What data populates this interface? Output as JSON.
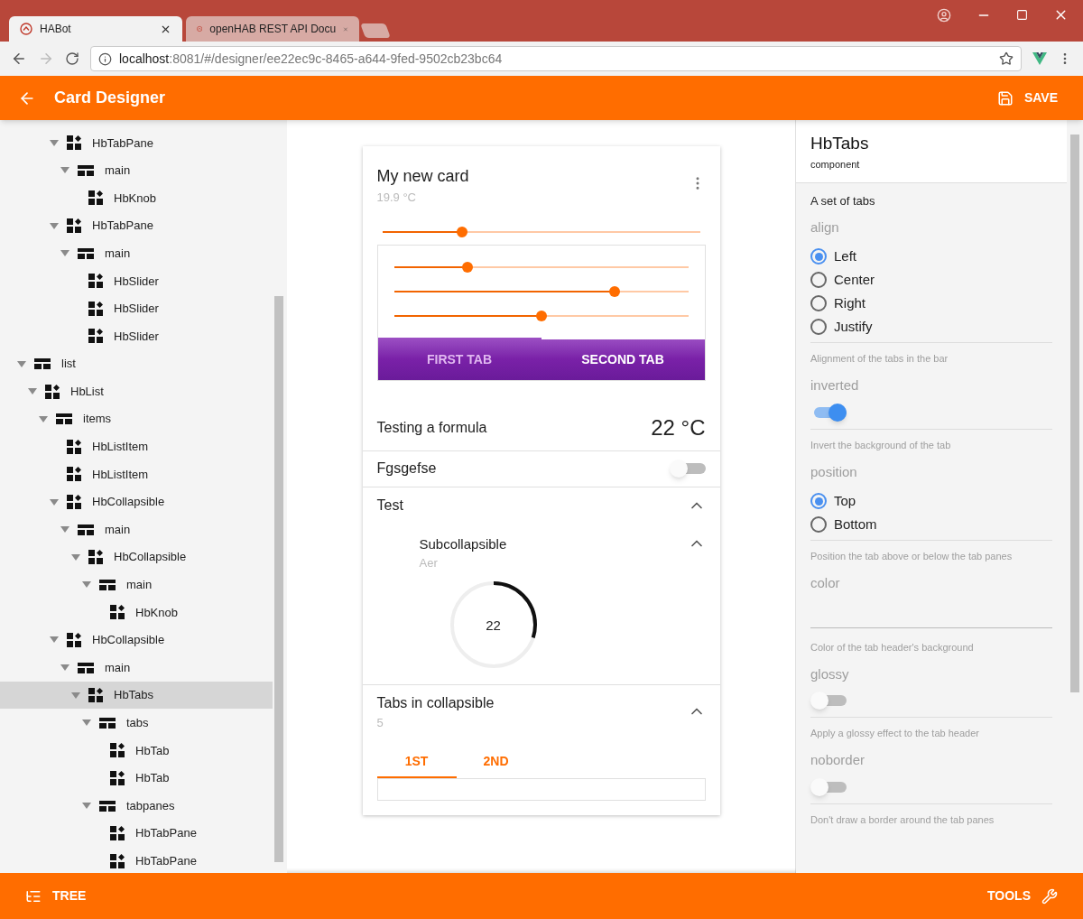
{
  "browser": {
    "tabs": [
      {
        "title": "HABot",
        "selected": true
      },
      {
        "title": "openHAB REST API Docu",
        "selected": false
      }
    ],
    "url_host": "localhost",
    "url_path": ":8081/#/designer/ee22ec9c-8465-a644-9fed-9502cb23bc64"
  },
  "header": {
    "title": "Card Designer",
    "save": "SAVE"
  },
  "tree": {
    "scrolled_branch": [
      {
        "label": "HbTabPane",
        "kind": "component",
        "expanded": true,
        "selected": false,
        "children": [
          {
            "label": "main",
            "kind": "slot",
            "expanded": true,
            "selected": false,
            "children": [
              {
                "label": "HbKnob",
                "kind": "component",
                "selected": false
              }
            ]
          }
        ]
      },
      {
        "label": "HbTabPane",
        "kind": "component",
        "expanded": true,
        "selected": false,
        "children": [
          {
            "label": "main",
            "kind": "slot",
            "expanded": true,
            "selected": false,
            "children": [
              {
                "label": "HbSlider",
                "kind": "component",
                "selected": false
              },
              {
                "label": "HbSlider",
                "kind": "component",
                "selected": false
              },
              {
                "label": "HbSlider",
                "kind": "component",
                "selected": false
              }
            ]
          }
        ]
      }
    ],
    "items": [
      {
        "label": "list",
        "kind": "slot",
        "expanded": true,
        "selected": false,
        "children": [
          {
            "label": "HbList",
            "kind": "component",
            "expanded": true,
            "selected": false,
            "children": [
              {
                "label": "items",
                "kind": "slot",
                "expanded": true,
                "selected": false,
                "children": [
                  {
                    "label": "HbListItem",
                    "kind": "component",
                    "selected": false
                  },
                  {
                    "label": "HbListItem",
                    "kind": "component",
                    "selected": false
                  },
                  {
                    "label": "HbCollapsible",
                    "kind": "component",
                    "expanded": true,
                    "selected": false,
                    "children": [
                      {
                        "label": "main",
                        "kind": "slot",
                        "expanded": true,
                        "selected": false,
                        "children": [
                          {
                            "label": "HbCollapsible",
                            "kind": "component",
                            "expanded": true,
                            "selected": false,
                            "children": [
                              {
                                "label": "main",
                                "kind": "slot",
                                "expanded": true,
                                "selected": false,
                                "children": [
                                  {
                                    "label": "HbKnob",
                                    "kind": "component",
                                    "selected": false
                                  }
                                ]
                              }
                            ]
                          }
                        ]
                      }
                    ]
                  },
                  {
                    "label": "HbCollapsible",
                    "kind": "component",
                    "expanded": true,
                    "selected": false,
                    "children": [
                      {
                        "label": "main",
                        "kind": "slot",
                        "expanded": true,
                        "selected": false,
                        "children": [
                          {
                            "label": "HbTabs",
                            "kind": "component",
                            "expanded": true,
                            "selected": true,
                            "children": [
                              {
                                "label": "tabs",
                                "kind": "slot",
                                "expanded": true,
                                "selected": false,
                                "children": [
                                  {
                                    "label": "HbTab",
                                    "kind": "component",
                                    "selected": false
                                  },
                                  {
                                    "label": "HbTab",
                                    "kind": "component",
                                    "selected": false
                                  }
                                ]
                              },
                              {
                                "label": "tabpanes",
                                "kind": "slot",
                                "expanded": true,
                                "selected": false,
                                "children": [
                                  {
                                    "label": "HbTabPane",
                                    "kind": "component",
                                    "selected": false
                                  },
                                  {
                                    "label": "HbTabPane",
                                    "kind": "component",
                                    "selected": false
                                  }
                                ]
                              }
                            ]
                          }
                        ]
                      }
                    ]
                  }
                ]
              }
            ]
          }
        ]
      }
    ]
  },
  "card": {
    "title": "My new card",
    "subtitle": "19.9 °C",
    "slider": {
      "level": 0.25
    },
    "tabs_block": {
      "sliders": [
        {
          "level": 0.25
        },
        {
          "level": 0.75
        },
        {
          "level": 0.5
        }
      ],
      "tabs": [
        {
          "label": "FIRST TAB",
          "selected": false
        },
        {
          "label": "SECOND TAB",
          "selected": true
        }
      ]
    },
    "list": [
      {
        "kind": "value",
        "label": "Testing a formula",
        "value": "22 °C"
      },
      {
        "kind": "toggle",
        "label": "Fgsgefse",
        "on": false
      },
      {
        "kind": "collapsible",
        "label": "Test",
        "expanded": true,
        "sub": {
          "title": "Subcollapsible",
          "subtitle": "Aer",
          "expanded": true,
          "knob": {
            "value": "22",
            "level": 0.3
          }
        }
      },
      {
        "kind": "tabs",
        "label": "Tabs in collapsible",
        "subtitle": "5",
        "expanded": true,
        "tabs": [
          {
            "label": "1ST",
            "selected": true
          },
          {
            "label": "2ND",
            "selected": false
          }
        ]
      }
    ]
  },
  "properties": {
    "title": "HbTabs",
    "type": "component",
    "description": "A set of tabs",
    "props": [
      {
        "kind": "radio",
        "name": "align",
        "options": [
          {
            "label": "Left",
            "selected": true
          },
          {
            "label": "Center",
            "selected": false
          },
          {
            "label": "Right",
            "selected": false
          },
          {
            "label": "Justify",
            "selected": false
          }
        ],
        "help": "Alignment of the tabs in the bar"
      },
      {
        "kind": "toggle",
        "name": "inverted",
        "on": true,
        "help": "Invert the background of the tab"
      },
      {
        "kind": "radio",
        "name": "position",
        "options": [
          {
            "label": "Top",
            "selected": true
          },
          {
            "label": "Bottom",
            "selected": false
          }
        ],
        "help": "Position the tab above or below the tab panes"
      },
      {
        "kind": "text",
        "name": "color",
        "help": "Color of the tab header's background"
      },
      {
        "kind": "toggle",
        "name": "glossy",
        "on": false,
        "help": "Apply a glossy effect to the tab header"
      },
      {
        "kind": "toggle",
        "name": "noborder",
        "on": false,
        "help": "Don't draw a border around the tab panes"
      }
    ]
  },
  "footer": {
    "tree": "TREE",
    "tools": "TOOLS"
  }
}
